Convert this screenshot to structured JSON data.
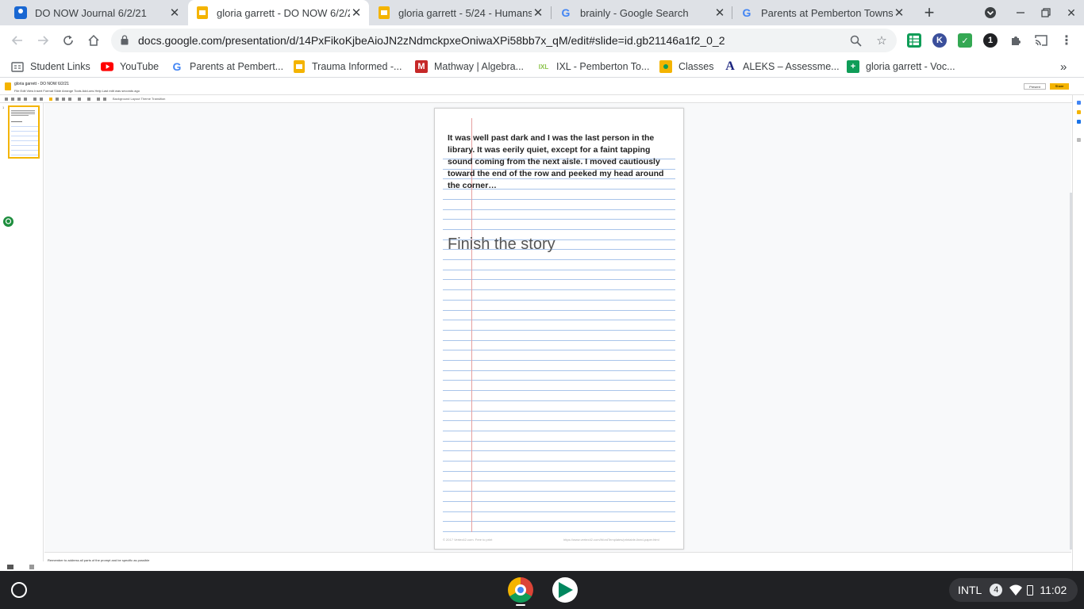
{
  "browser": {
    "tabs": [
      {
        "title": "DO NOW Journal 6/2/21",
        "favicon": "classroom-icon"
      },
      {
        "title": "gloria garrett - DO NOW 6/2/21",
        "favicon": "slides-icon",
        "active": true
      },
      {
        "title": "gloria garrett - 5/24 - Humans",
        "favicon": "slides-icon"
      },
      {
        "title": "brainly - Google Search",
        "favicon": "google-icon"
      },
      {
        "title": "Parents at Pemberton Townsh",
        "favicon": "google-icon"
      }
    ],
    "url": "docs.google.com/presentation/d/14PxFikoKjbeAioJN2zNdmckpxeOniwaXPi58bb7x_qM/edit#slide=id.gb21146a1f2_0_2",
    "bookmarks": [
      {
        "label": "Student Links",
        "icon": "folder-icon"
      },
      {
        "label": "YouTube",
        "icon": "youtube-icon"
      },
      {
        "label": "Parents at Pembert...",
        "icon": "google-icon"
      },
      {
        "label": "Trauma Informed -...",
        "icon": "folder-icon"
      },
      {
        "label": "Mathway | Algebra...",
        "icon": "mathway-icon"
      },
      {
        "label": "IXL - Pemberton To...",
        "icon": "ixl-icon"
      },
      {
        "label": "Classes",
        "icon": "classroom-icon"
      },
      {
        "label": "ALEKS – Assessme...",
        "icon": "aleks-icon"
      },
      {
        "label": "gloria garrett - Voc...",
        "icon": "sheets-icon"
      }
    ],
    "more_bookmarks": "»"
  },
  "slides_app": {
    "doc_title": "gloria garrett - DO NOW 6/2/21",
    "menus": "File   Edit   View   Insert   Format   Slide   Arrange   Tools   Add-ons   Help   Last edit was seconds ago",
    "toolbar_text": "Background   Layout   Theme   Transition",
    "present_label": "Present",
    "share_label": "Share",
    "thumb_number": "1",
    "notes_text": "Remember to address all parts of the prompt and be specific as possible"
  },
  "slide": {
    "prompt": "It was well past dark and I was the last person in the library. It was eerily quiet, except for a faint tapping sound coming from the next aisle. I moved cautiously toward the end of the row and peeked my head around the corner…",
    "instruction": "Finish the story",
    "footer_left": "© 2017 Vertex42.com. Free to print",
    "footer_right": "https://www.vertex42.com/WordTemplates/printable-lined-paper.html"
  },
  "shelf": {
    "keyboard": "INTL",
    "notification_count": "4",
    "time": "11:02"
  },
  "colors": {
    "slides_yellow": "#f4b400",
    "rule_blue": "#a8c4ea",
    "margin_red": "#e6a0a0",
    "shelf_bg": "#202124"
  }
}
